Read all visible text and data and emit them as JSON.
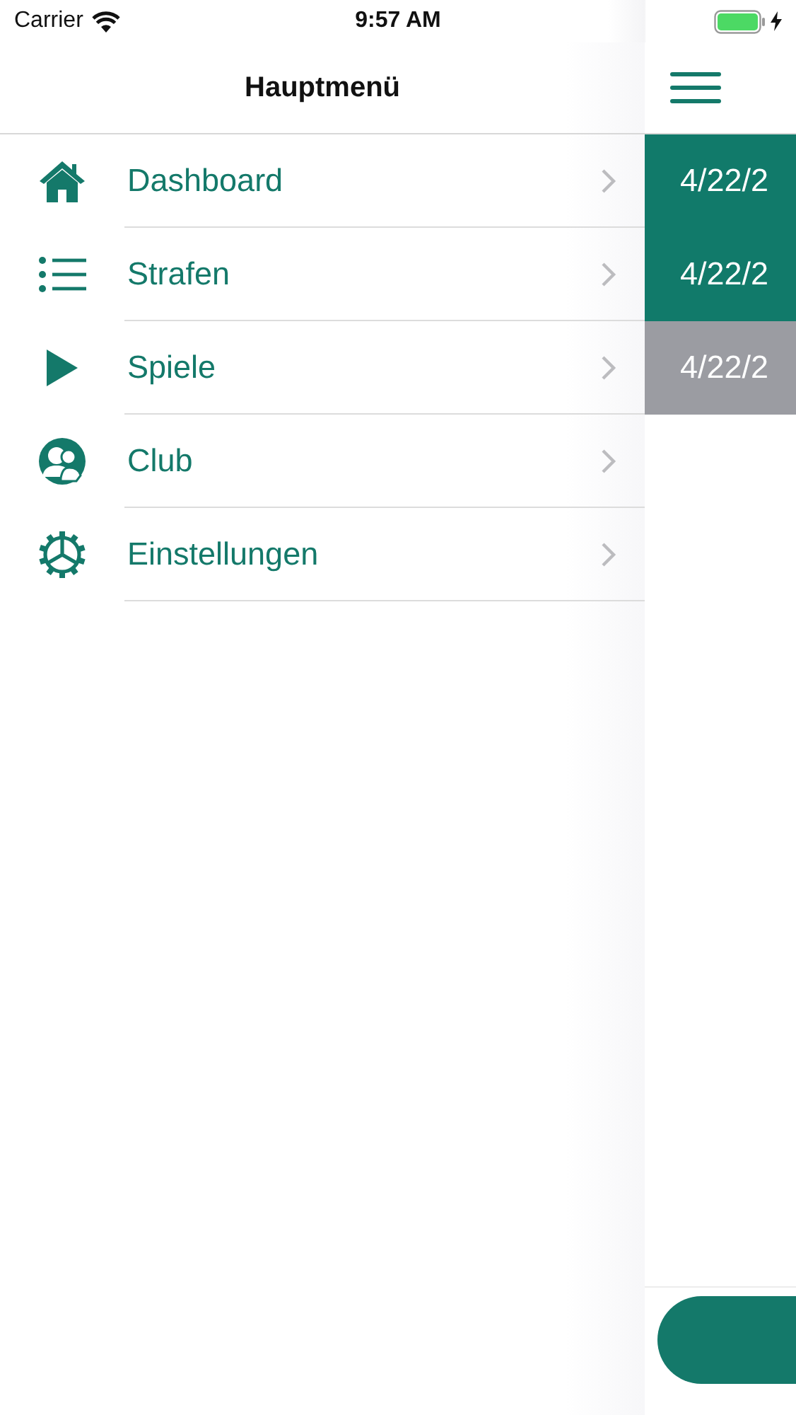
{
  "status_bar": {
    "carrier": "Carrier",
    "time": "9:57 AM"
  },
  "drawer": {
    "title": "Hauptmenü",
    "items": [
      {
        "label": "Dashboard"
      },
      {
        "label": "Strafen"
      },
      {
        "label": "Spiele"
      },
      {
        "label": "Club"
      },
      {
        "label": "Einstellungen"
      }
    ]
  },
  "content": {
    "rows": [
      {
        "text": "4/22/2",
        "color": "#117a6a"
      },
      {
        "text": "4/22/2",
        "color": "#117a6a"
      },
      {
        "text": "4/22/2",
        "color": "#9b9ca2"
      }
    ]
  }
}
